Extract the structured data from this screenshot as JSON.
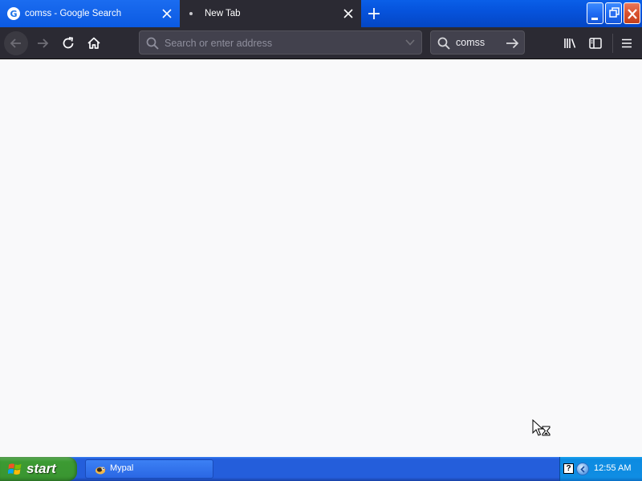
{
  "tabs": [
    {
      "label": "comss - Google Search",
      "favicon": "google-g-icon",
      "favicon_letter": "G",
      "active": false
    },
    {
      "label": "New Tab",
      "active": true
    }
  ],
  "toolbar": {
    "url_placeholder": "Search or enter address",
    "search_value": "comss"
  },
  "taskbar": {
    "start_label": "start",
    "items": [
      {
        "label": "Mypal",
        "icon": "mypal-bird-icon"
      }
    ],
    "tray_help": "?",
    "clock": "12:55 AM"
  },
  "colors": {
    "toolbar_bg": "#2b2a33",
    "content_bg": "#f9f9fa",
    "tabstrip_blue": "#0653dc",
    "start_green": "#3c9a33",
    "taskbar_blue": "#245edb"
  }
}
